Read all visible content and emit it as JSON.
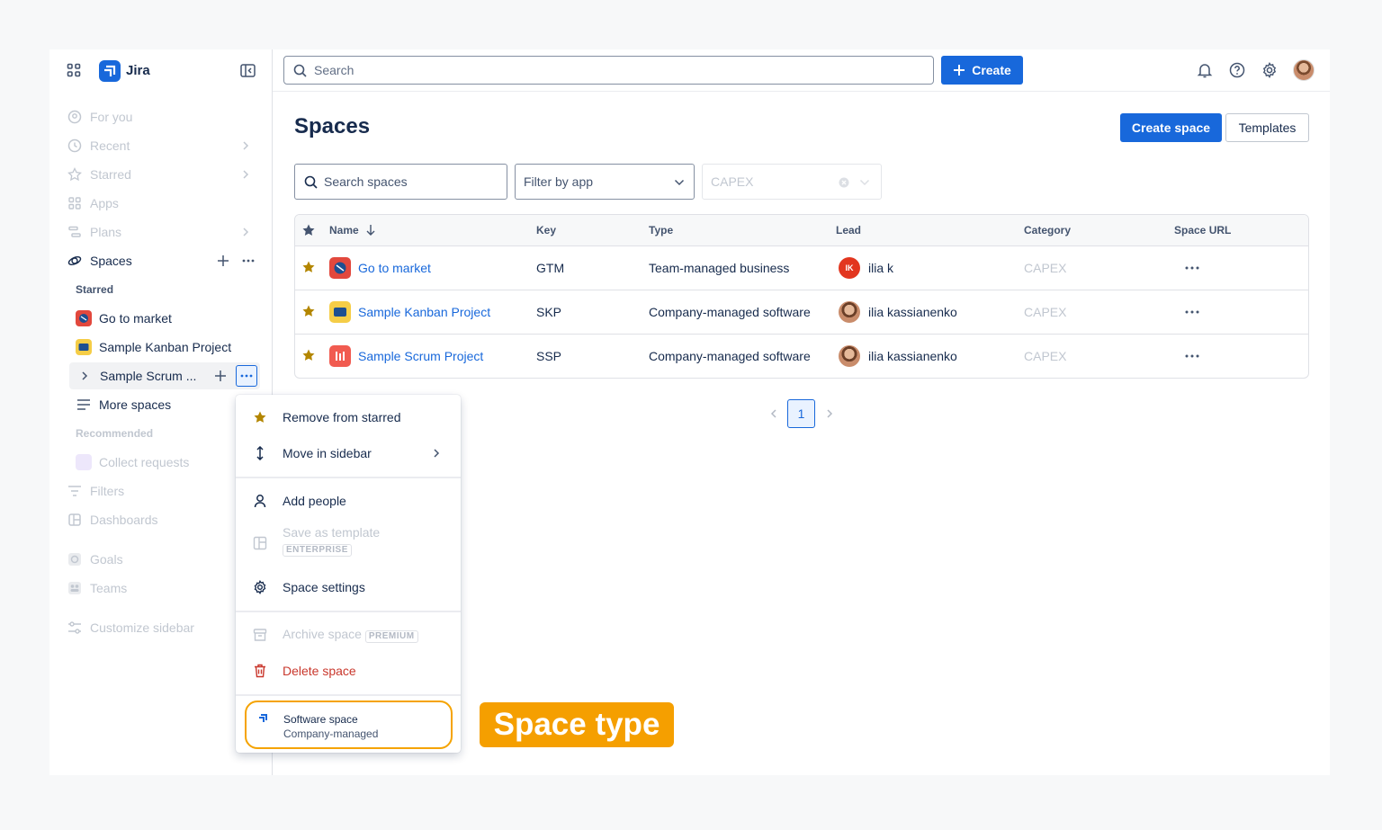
{
  "header": {
    "app_name": "Jira",
    "search_placeholder": "Search",
    "create_label": "Create"
  },
  "sidebar": {
    "nav": [
      {
        "label": "For you"
      },
      {
        "label": "Recent"
      },
      {
        "label": "Starred"
      },
      {
        "label": "Apps"
      },
      {
        "label": "Plans"
      }
    ],
    "spaces_label": "Spaces",
    "starred_label": "Starred",
    "starred_spaces": [
      {
        "label": "Go to market",
        "color": "#e2483d"
      },
      {
        "label": "Sample Kanban Project",
        "color": "#f5cd47"
      },
      {
        "label": "Sample Scrum ...",
        "color": "#f15b50"
      }
    ],
    "more_spaces": "More spaces",
    "recommended_label": "Recommended",
    "recommended_item": "Collect requests",
    "nav_bottom": [
      {
        "label": "Filters"
      },
      {
        "label": "Dashboards"
      },
      {
        "label": "Goals"
      },
      {
        "label": "Teams"
      },
      {
        "label": "Customize sidebar"
      }
    ]
  },
  "main": {
    "title": "Spaces",
    "create_space": "Create space",
    "templates": "Templates",
    "search_spaces_placeholder": "Search spaces",
    "filter_by_app": "Filter by app",
    "category_filter": "CAPEX",
    "columns": [
      "Name",
      "Key",
      "Type",
      "Lead",
      "Category",
      "Space URL"
    ],
    "rows": [
      {
        "name": "Go to market",
        "key": "GTM",
        "type": "Team-managed business",
        "lead": "ilia k",
        "lead_initials": "IK",
        "category": "CAPEX"
      },
      {
        "name": "Sample Kanban Project",
        "key": "SKP",
        "type": "Company-managed software",
        "lead": "ilia kassianenko",
        "lead_initials": "",
        "category": "CAPEX"
      },
      {
        "name": "Sample Scrum Project",
        "key": "SSP",
        "type": "Company-managed software",
        "lead": "ilia kassianenko",
        "lead_initials": "",
        "category": "CAPEX"
      }
    ],
    "current_page": "1"
  },
  "context_menu": {
    "remove_starred": "Remove from starred",
    "move_sidebar": "Move in sidebar",
    "add_people": "Add people",
    "save_template": "Save as template",
    "enterprise_badge": "ENTERPRISE",
    "space_settings": "Space settings",
    "archive_space": "Archive space",
    "premium_badge": "PREMIUM",
    "delete_space": "Delete space",
    "space_type_title": "Software space",
    "space_type_sub": "Company-managed"
  },
  "callout": {
    "label": "Space type",
    "color": "#f59f00"
  },
  "colors": {
    "accent": "#1868db",
    "star": "#b38600",
    "danger": "#c9372c"
  }
}
